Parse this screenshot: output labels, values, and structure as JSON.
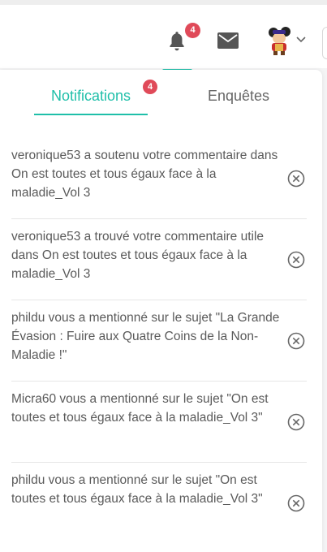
{
  "header": {
    "bell_icon": "bell-icon",
    "bell_badge": "4",
    "mail_icon": "mail-icon",
    "avatar_icon": "user-avatar-icon",
    "chevron_icon": "chevron-down-icon",
    "accent_color": "#1fbfa9",
    "badge_color": "#e04a59"
  },
  "tabs": {
    "notifications_label": "Notifications",
    "notifications_badge": "4",
    "surveys_label": "Enquêtes"
  },
  "notifications": [
    {
      "text": "veronique53 a soutenu votre commentaire dans On est toutes et tous égaux face à la maladie_Vol 3"
    },
    {
      "text": "veronique53 a trouvé votre commentaire utile dans On est toutes et tous égaux face à la maladie_Vol 3"
    },
    {
      "text": "phildu vous a mentionné sur le sujet \"La Grande Évasion : Fuire aux Quatre Coins de la Non-Maladie !\""
    },
    {
      "text": "Micra60 vous a mentionné sur le sujet \"On est toutes et tous égaux face à la maladie_Vol 3\""
    },
    {
      "text": "phildu vous a mentionné sur le sujet \"On est toutes et tous égaux face à la maladie_Vol 3\""
    }
  ]
}
